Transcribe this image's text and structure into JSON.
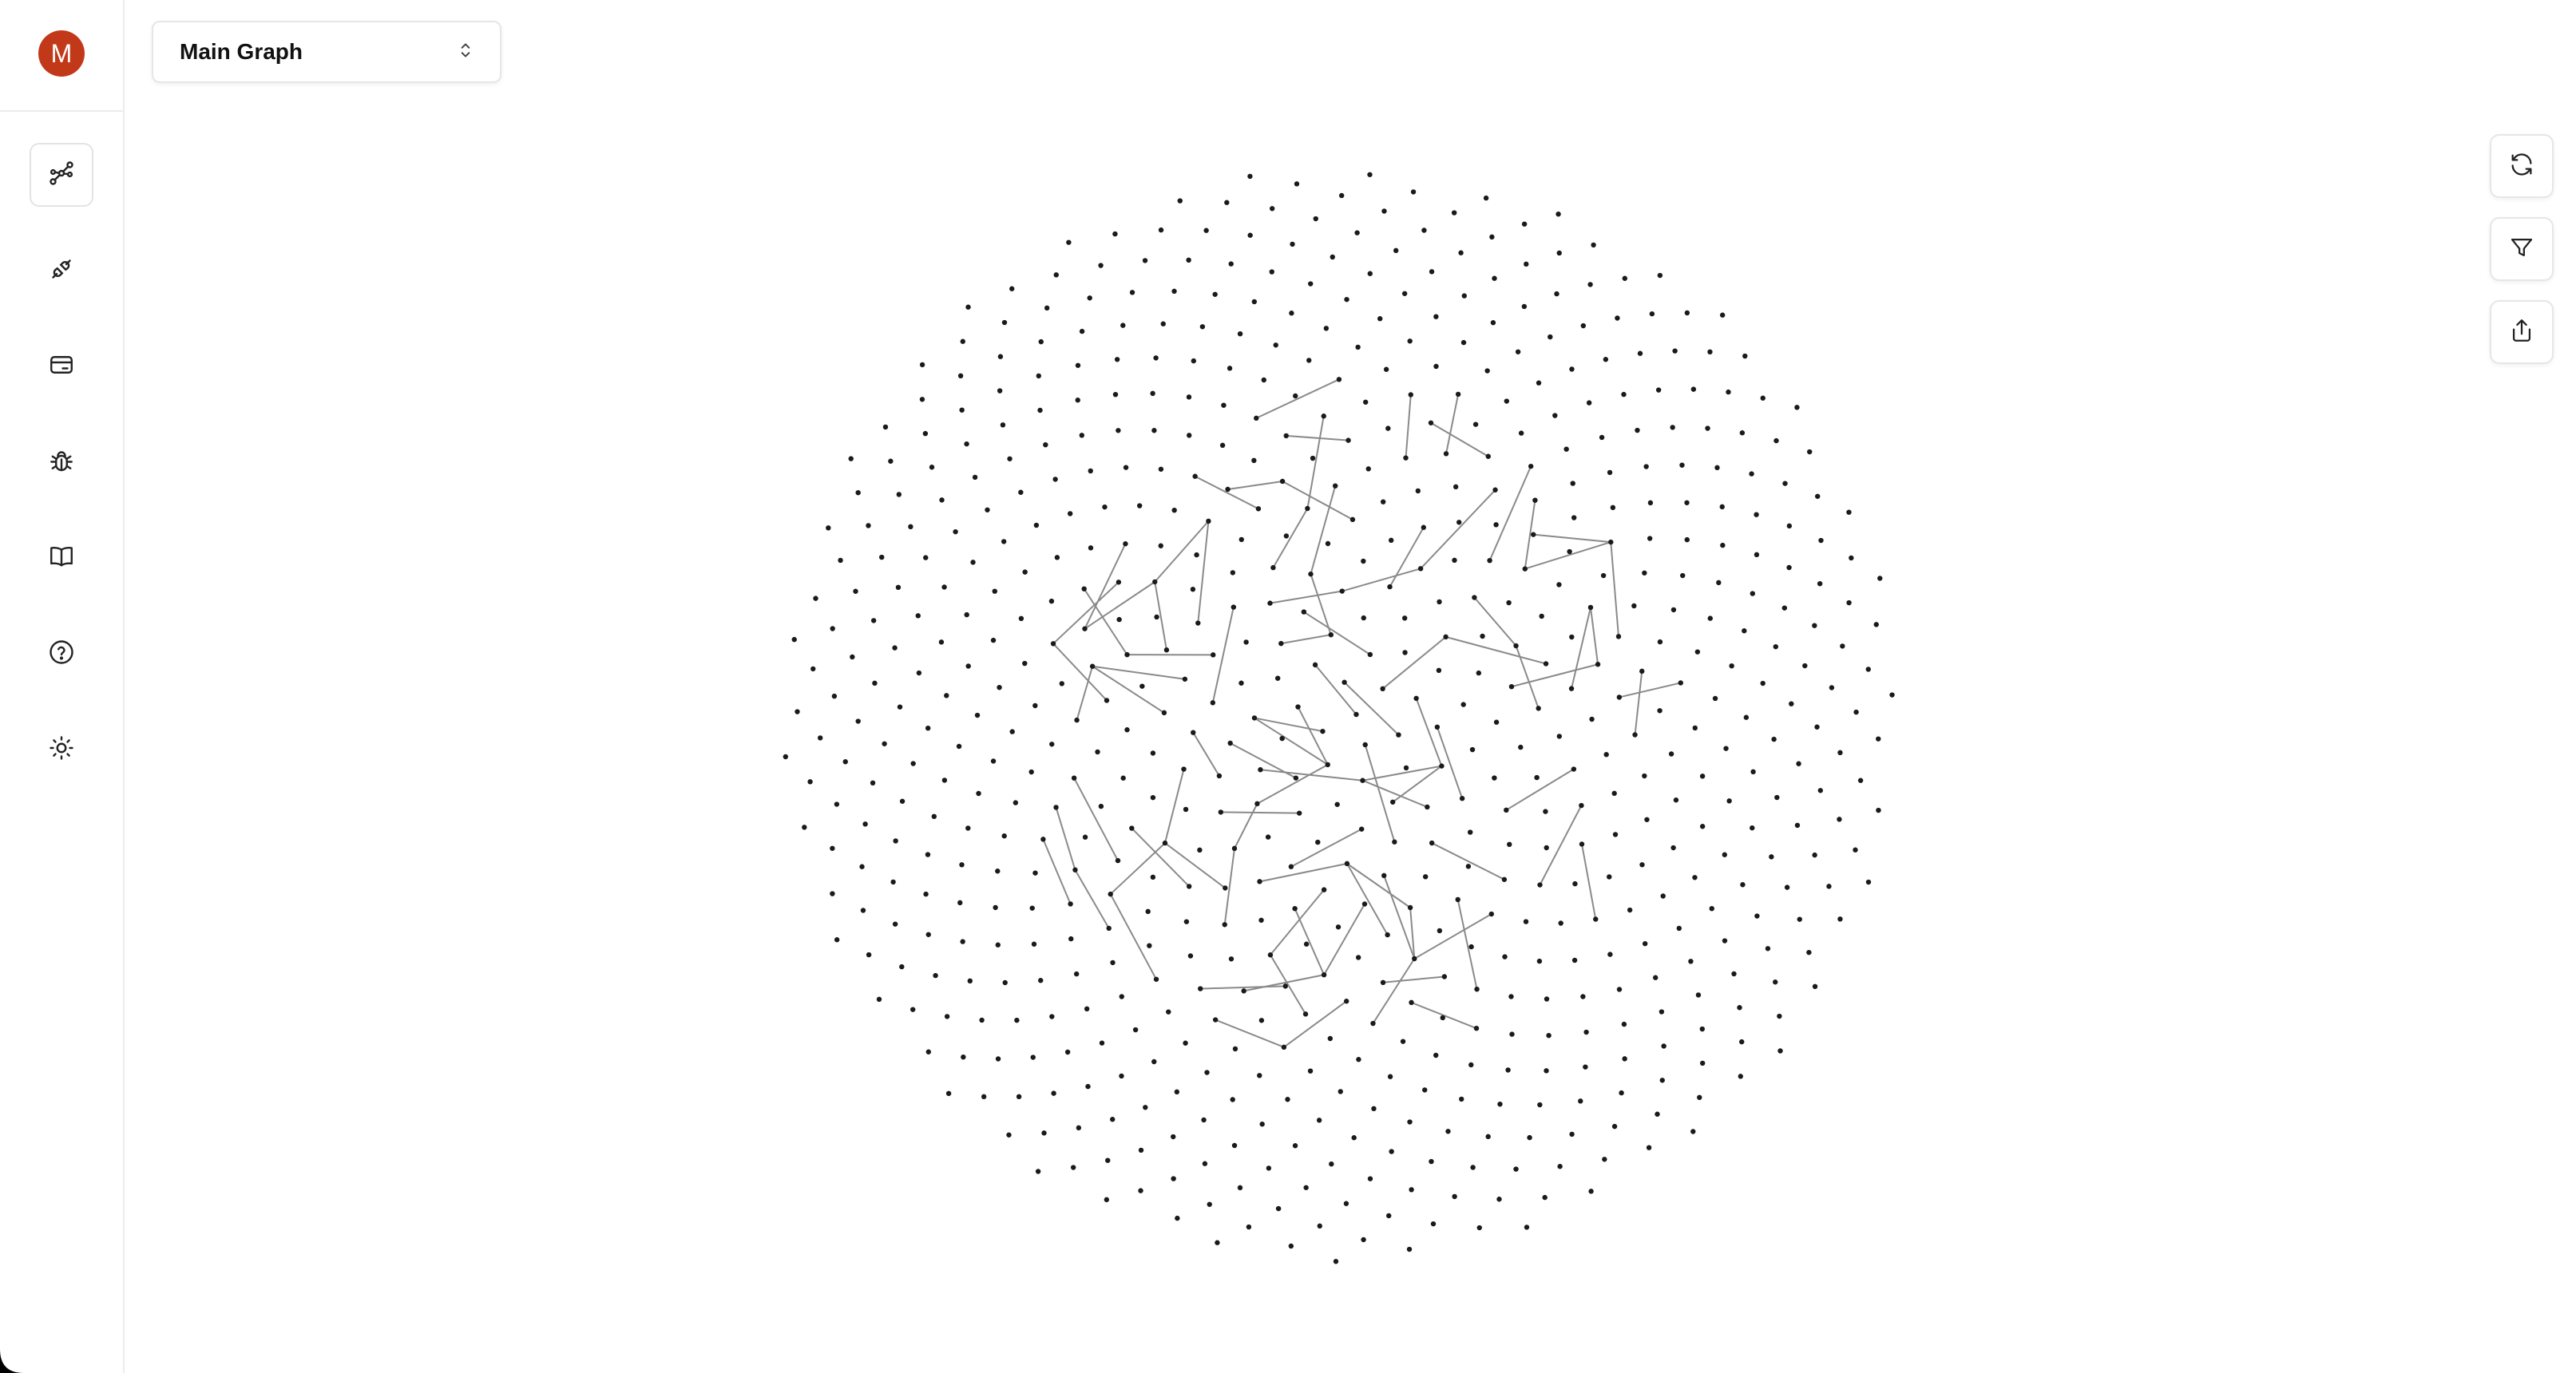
{
  "user": {
    "avatar_initial": "M",
    "avatar_color": "#c2391a"
  },
  "sidebar": {
    "items": [
      {
        "icon": "graph-icon",
        "active": true
      },
      {
        "icon": "plug-icon",
        "active": false
      },
      {
        "icon": "card-icon",
        "active": false
      },
      {
        "icon": "bug-icon",
        "active": false
      },
      {
        "icon": "book-icon",
        "active": false
      },
      {
        "icon": "help-icon",
        "active": false
      },
      {
        "icon": "sun-icon",
        "active": false
      }
    ]
  },
  "graph_selector": {
    "selected": "Main Graph",
    "icon": "chevron-up-down-icon"
  },
  "toolbar": {
    "buttons": [
      {
        "icon": "refresh-icon"
      },
      {
        "icon": "filter-icon"
      },
      {
        "icon": "export-icon"
      }
    ]
  },
  "graph": {
    "node_color": "#1a1a1a",
    "edge_color": "#8a8a8a"
  }
}
